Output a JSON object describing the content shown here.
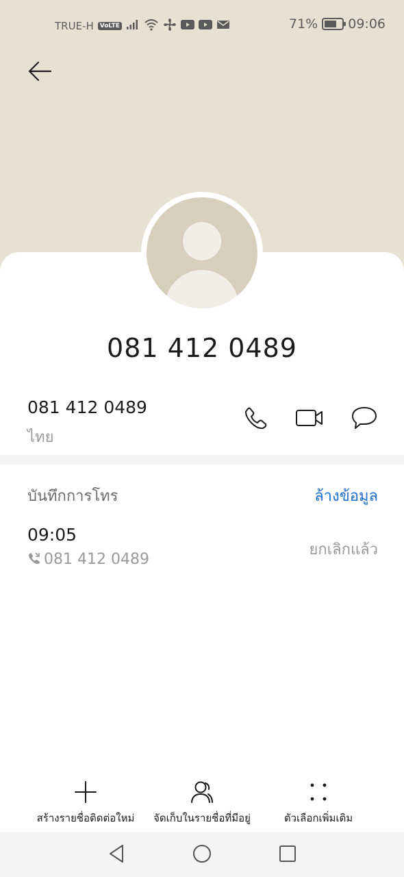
{
  "status_bar": {
    "carrier": "TRUE-H",
    "volte": "VoLTE",
    "battery_percent_text": "71%",
    "battery_level": 0.71,
    "time": "09:06",
    "icons": [
      "signal-icon",
      "wifi-icon",
      "fan-icon",
      "youtube-icon",
      "youtube-icon",
      "mail-icon"
    ]
  },
  "header": {
    "back_icon": "back-arrow-icon"
  },
  "contact": {
    "title": "081 412 0489",
    "number": "081 412 0489",
    "region": "ไทย"
  },
  "actions": {
    "icons": [
      "phone-icon",
      "video-call-icon",
      "message-icon"
    ]
  },
  "call_log": {
    "header": "บันทึกการโทร",
    "clear_label": "ล้างข้อมูล",
    "entries": [
      {
        "time": "09:05",
        "number": "081 412 0489",
        "status": "ยกเลิกแล้ว"
      }
    ]
  },
  "bottom_bar": {
    "items": [
      {
        "label": "สร้างรายชื่อติดต่อใหม่",
        "icon": "plus-icon"
      },
      {
        "label": "จัดเก็บในรายชื่อที่มีอยู่",
        "icon": "person-icon"
      },
      {
        "label": "ตัวเลือกเพิ่มเติม",
        "icon": "more-options-icon"
      }
    ]
  },
  "nav_bar": {
    "icons": [
      "nav-back-icon",
      "nav-home-icon",
      "nav-recents-icon"
    ]
  },
  "colors": {
    "header_bg": "#e7e1d1",
    "avatar_bg": "#d7cfbb",
    "accent_blue": "#1e6fd0"
  }
}
